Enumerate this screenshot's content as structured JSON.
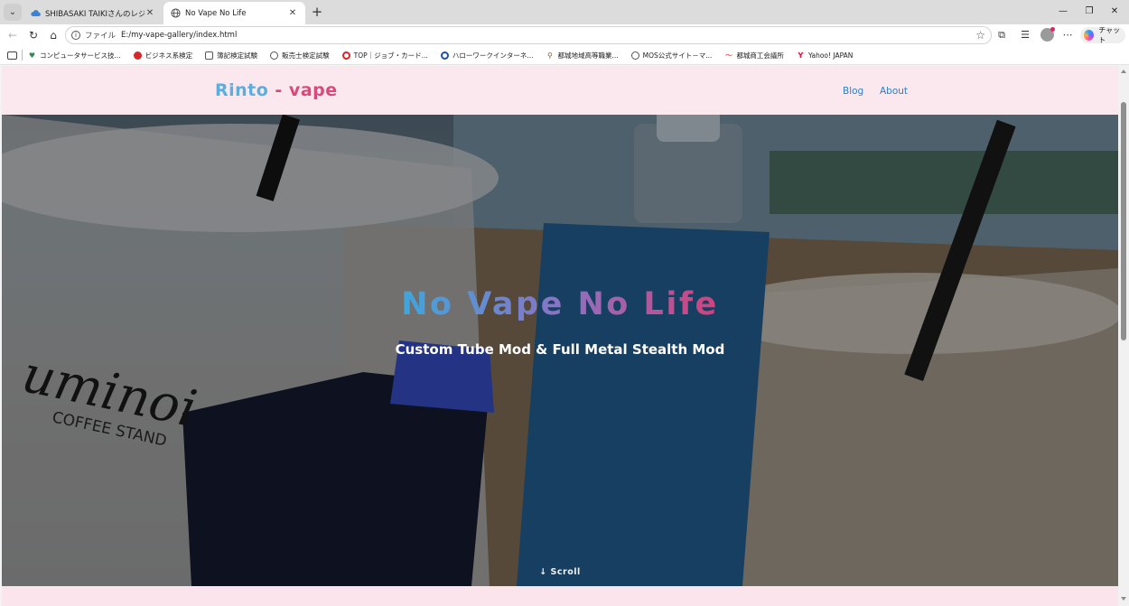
{
  "browser": {
    "tabs": [
      {
        "title": "SHIBASAKI TAIKIさんのレジュメ | RES",
        "icon": "cloud-icon",
        "active": false
      },
      {
        "title": "No Vape No Life",
        "icon": "globe-icon",
        "active": true
      }
    ],
    "address": {
      "scheme_label": "ファイル",
      "url": "E:/my-vape-gallery/index.html"
    },
    "copilot_label": "チャット",
    "bookmarks": [
      {
        "label": "コンピュータサービス技...",
        "icon": "heart-icon",
        "color": "#2e8b57"
      },
      {
        "label": "ビジネス系検定",
        "icon": "red-logo-icon",
        "color": "#d62828"
      },
      {
        "label": "簿記検定試験",
        "icon": "grid-icon",
        "color": "#555555"
      },
      {
        "label": "販売士検定試験",
        "icon": "globe-icon",
        "color": "#555555"
      },
      {
        "label": "TOP｜ジョブ・カード...",
        "icon": "hellowork-icon",
        "color": "#d62828"
      },
      {
        "label": "ハローワークインターネ...",
        "icon": "hellowork-icon",
        "color": "#1f4fa8"
      },
      {
        "label": "都城地域高等職業...",
        "icon": "pin-icon",
        "color": "#7a5c2e"
      },
      {
        "label": "MOS公式サイト－マ...",
        "icon": "globe-icon",
        "color": "#555555"
      },
      {
        "label": "都城商工会議所",
        "icon": "swoosh-icon",
        "color": "#d62828"
      },
      {
        "label": "Yahoo! JAPAN",
        "icon": "yahoo-icon",
        "color": "#ff0033"
      }
    ]
  },
  "site": {
    "logo_part1": "Rinto",
    "logo_part2": " - vape",
    "nav": [
      "Blog",
      "About"
    ],
    "hero": {
      "title": "No Vape No Life",
      "subtitle": "Custom Tube Mod & Full Metal Stealth Mod",
      "scroll_label": "↓ Scroll"
    },
    "colors": {
      "header_bg": "#fae8ee",
      "logo_blue": "#5aaee0",
      "logo_pink": "#d94a78",
      "nav_link": "#2d7fc1",
      "title_gradient": [
        "#3fa6dd",
        "#8a73c2",
        "#d2427c"
      ]
    }
  }
}
